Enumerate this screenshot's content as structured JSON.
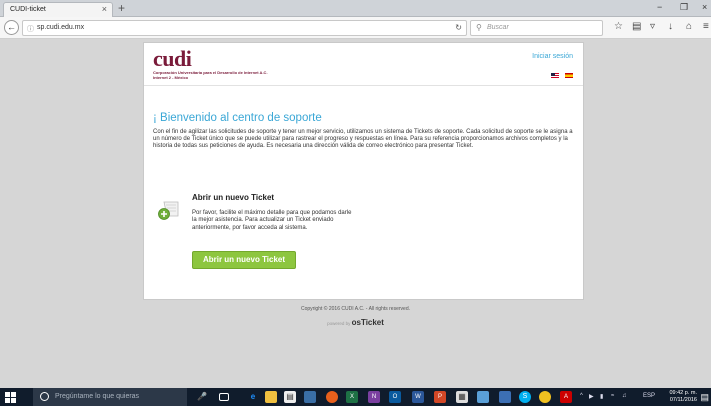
{
  "browser": {
    "tab_title": "CUDI-ticket",
    "tab_close": "×",
    "new_tab": "+",
    "url": "sp.cudi.edu.mx",
    "search_placeholder": "Buscar",
    "window_controls": [
      "−",
      "❐",
      "×"
    ],
    "nav_icons": [
      "star-icon",
      "bookmarks-icon",
      "pocket-icon",
      "download-icon",
      "home-icon",
      "menu-icon"
    ]
  },
  "header": {
    "logo_word": "cudi",
    "logo_line1": "Corporación Universitaria para el Desarrollo de Internet A.C.",
    "logo_line2": "Internet 2 - México",
    "login_link": "Iniciar sesión"
  },
  "main": {
    "welcome": "¡ Bienvenido al centro de soporte",
    "intro": "Con el fin de agilizar las solicitudes de soporte y tener un mejor servicio, utilizamos un sistema de Tickets de soporte. Cada solicitud de soporte se le asigna a un número de Ticket único que se puede utilizar para rastrear el progreso y respuestas en línea. Para su referencia proporcionamos archivos completos y la historia de todas sus peticiones de ayuda. Es necesaria una dirección válida de correo electrónico para presentar Ticket.",
    "ticket_title": "Abrir un nuevo Ticket",
    "ticket_desc": "Por favor, facilite el máximo detalle para que podamos darle la mejor asistencia. Para actualizar un Ticket enviado anteriormente, por favor acceda al sistema.",
    "ticket_button": "Abrir un nuevo Ticket"
  },
  "footer": {
    "copyright": "Copyright © 2016 CUDI A.C. - All rights reserved.",
    "powered_by": "powered by",
    "powered_brand": "osTicket"
  },
  "taskbar": {
    "search_placeholder": "Pregúntame lo que quieras",
    "language": "ESP",
    "time": "09:42 p. m.",
    "date": "07/11/2016"
  },
  "colors": {
    "accent_blue": "#3aa7d6",
    "brand_maroon": "#7a1b3a",
    "button_green": "#8dc63f"
  }
}
